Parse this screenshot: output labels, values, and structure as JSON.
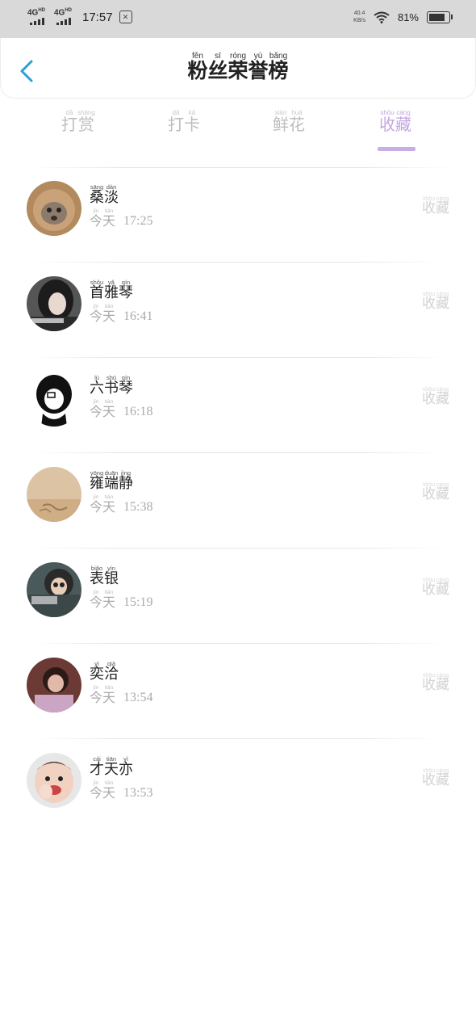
{
  "status_bar": {
    "net1": "4G",
    "net1_sup": "HD",
    "net2": "4G",
    "net2_sup": "HD",
    "time": "17:57",
    "speed_value": "40.4",
    "speed_unit": "KB/s",
    "battery_percent": "81%",
    "battery_level": 0.81
  },
  "header": {
    "title": [
      {
        "h": "粉",
        "p": "fěn"
      },
      {
        "h": "丝",
        "p": "sī"
      },
      {
        "h": "荣",
        "p": "róng"
      },
      {
        "h": "誉",
        "p": "yù"
      },
      {
        "h": "榜",
        "p": "bǎng"
      }
    ]
  },
  "tabs": [
    {
      "chars": [
        {
          "h": "打",
          "p": "dǎ"
        },
        {
          "h": "赏",
          "p": "shǎng"
        }
      ],
      "active": false
    },
    {
      "chars": [
        {
          "h": "打",
          "p": "dǎ"
        },
        {
          "h": "卡",
          "p": "kǎ"
        }
      ],
      "active": false
    },
    {
      "chars": [
        {
          "h": "鲜",
          "p": "xiān"
        },
        {
          "h": "花",
          "p": "huā"
        }
      ],
      "active": false
    },
    {
      "chars": [
        {
          "h": "收",
          "p": "shōu"
        },
        {
          "h": "藏",
          "p": "cáng"
        }
      ],
      "active": true
    }
  ],
  "items": [
    {
      "name": [
        {
          "h": "桑",
          "p": "sāng"
        },
        {
          "h": "淡",
          "p": "dàn"
        }
      ],
      "day": [
        {
          "h": "今",
          "p": "jīn"
        },
        {
          "h": "天",
          "p": "tiān"
        }
      ],
      "time": "17:25",
      "action": [
        {
          "h": "收",
          "p": "shōu"
        },
        {
          "h": "藏",
          "p": "cáng"
        }
      ]
    },
    {
      "name": [
        {
          "h": "首",
          "p": "shǒu"
        },
        {
          "h": "雅",
          "p": "yǎ"
        },
        {
          "h": "琴",
          "p": "qín"
        }
      ],
      "day": [
        {
          "h": "今",
          "p": "jīn"
        },
        {
          "h": "天",
          "p": "tiān"
        }
      ],
      "time": "16:41",
      "action": [
        {
          "h": "收",
          "p": "shōu"
        },
        {
          "h": "藏",
          "p": "cáng"
        }
      ]
    },
    {
      "name": [
        {
          "h": "六",
          "p": "lù"
        },
        {
          "h": "书",
          "p": "shū"
        },
        {
          "h": "琴",
          "p": "qín"
        }
      ],
      "day": [
        {
          "h": "今",
          "p": "jīn"
        },
        {
          "h": "天",
          "p": "tiān"
        }
      ],
      "time": "16:18",
      "action": [
        {
          "h": "收",
          "p": "shōu"
        },
        {
          "h": "藏",
          "p": "cáng"
        }
      ]
    },
    {
      "name": [
        {
          "h": "雍",
          "p": "yōng"
        },
        {
          "h": "端",
          "p": "duān"
        },
        {
          "h": "静",
          "p": "jìng"
        }
      ],
      "day": [
        {
          "h": "今",
          "p": "jīn"
        },
        {
          "h": "天",
          "p": "tiān"
        }
      ],
      "time": "15:38",
      "action": [
        {
          "h": "收",
          "p": "shōu"
        },
        {
          "h": "藏",
          "p": "cáng"
        }
      ]
    },
    {
      "name": [
        {
          "h": "表",
          "p": "biǎo"
        },
        {
          "h": "银",
          "p": "yín"
        }
      ],
      "day": [
        {
          "h": "今",
          "p": "jīn"
        },
        {
          "h": "天",
          "p": "tiān"
        }
      ],
      "time": "15:19",
      "action": [
        {
          "h": "收",
          "p": "shōu"
        },
        {
          "h": "藏",
          "p": "cáng"
        }
      ]
    },
    {
      "name": [
        {
          "h": "奕",
          "p": "yì"
        },
        {
          "h": "洽",
          "p": "qià"
        }
      ],
      "day": [
        {
          "h": "今",
          "p": "jīn"
        },
        {
          "h": "天",
          "p": "tiān"
        }
      ],
      "time": "13:54",
      "action": [
        {
          "h": "收",
          "p": "shōu"
        },
        {
          "h": "藏",
          "p": "cáng"
        }
      ]
    },
    {
      "name": [
        {
          "h": "才",
          "p": "cái"
        },
        {
          "h": "天",
          "p": "tiān"
        },
        {
          "h": "亦",
          "p": "yì"
        }
      ],
      "day": [
        {
          "h": "今",
          "p": "jīn"
        },
        {
          "h": "天",
          "p": "tiān"
        }
      ],
      "time": "13:53",
      "action": [
        {
          "h": "收",
          "p": "shōu"
        },
        {
          "h": "藏",
          "p": "cáng"
        }
      ]
    }
  ],
  "colors": {
    "accent": "#c3a6e0",
    "back_icon": "#2a9fd8"
  }
}
